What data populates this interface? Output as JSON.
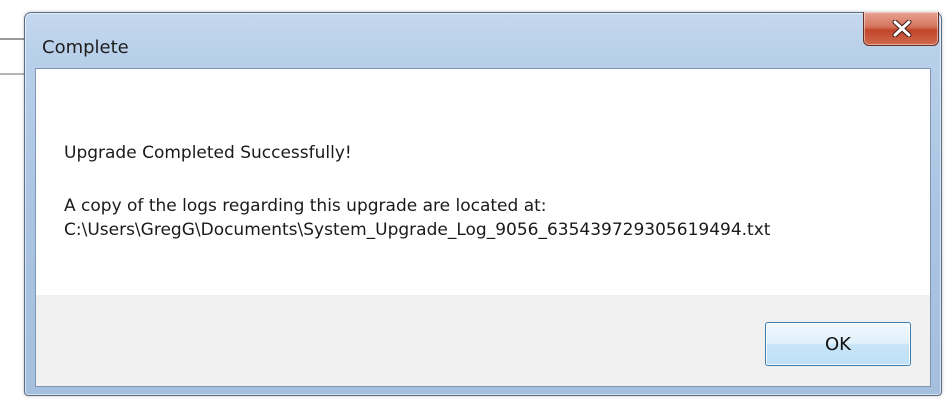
{
  "window": {
    "title": "Complete",
    "close_icon": "close-icon"
  },
  "message": {
    "heading": "Upgrade Completed Successfully!",
    "line1": "A copy of the logs regarding this upgrade are located at:",
    "line2": "C:\\Users\\GregG\\Documents\\System_Upgrade_Log_9056_635439729305619494.txt"
  },
  "buttons": {
    "ok_label": "OK"
  },
  "colors": {
    "frame": "#b9d0ea",
    "close_button": "#c2452a",
    "ok_border": "#3c7fb1",
    "content_bg": "#ffffff",
    "footer_bg": "#f0f0f0"
  }
}
